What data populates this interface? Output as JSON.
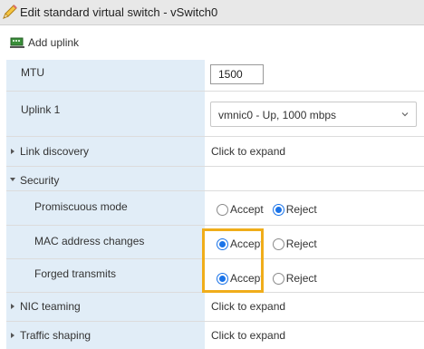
{
  "dialog": {
    "title": "Edit standard virtual switch - vSwitch0"
  },
  "toolbar": {
    "add_uplink_label": "Add uplink"
  },
  "rows": {
    "mtu": {
      "label": "MTU",
      "value": "1500"
    },
    "uplink1": {
      "label": "Uplink 1",
      "selected": "vmnic0 - Up, 1000 mbps"
    },
    "link_discovery": {
      "label": "Link discovery",
      "value": "Click to expand"
    },
    "security": {
      "label": "Security"
    },
    "promiscuous": {
      "label": "Promiscuous mode",
      "accept": "Accept",
      "reject": "Reject",
      "selected": "Reject"
    },
    "mac_changes": {
      "label": "MAC address changes",
      "accept": "Accept",
      "reject": "Reject",
      "selected": "Accept"
    },
    "forged": {
      "label": "Forged transmits",
      "accept": "Accept",
      "reject": "Reject",
      "selected": "Accept"
    },
    "nic_teaming": {
      "label": "NIC teaming",
      "value": "Click to expand"
    },
    "traffic_shaping": {
      "label": "Traffic shaping",
      "value": "Click to expand"
    }
  },
  "colors": {
    "label_bg": "#e1edf7",
    "radio_selected": "#1a73e8",
    "highlight": "#f0ad1a"
  }
}
